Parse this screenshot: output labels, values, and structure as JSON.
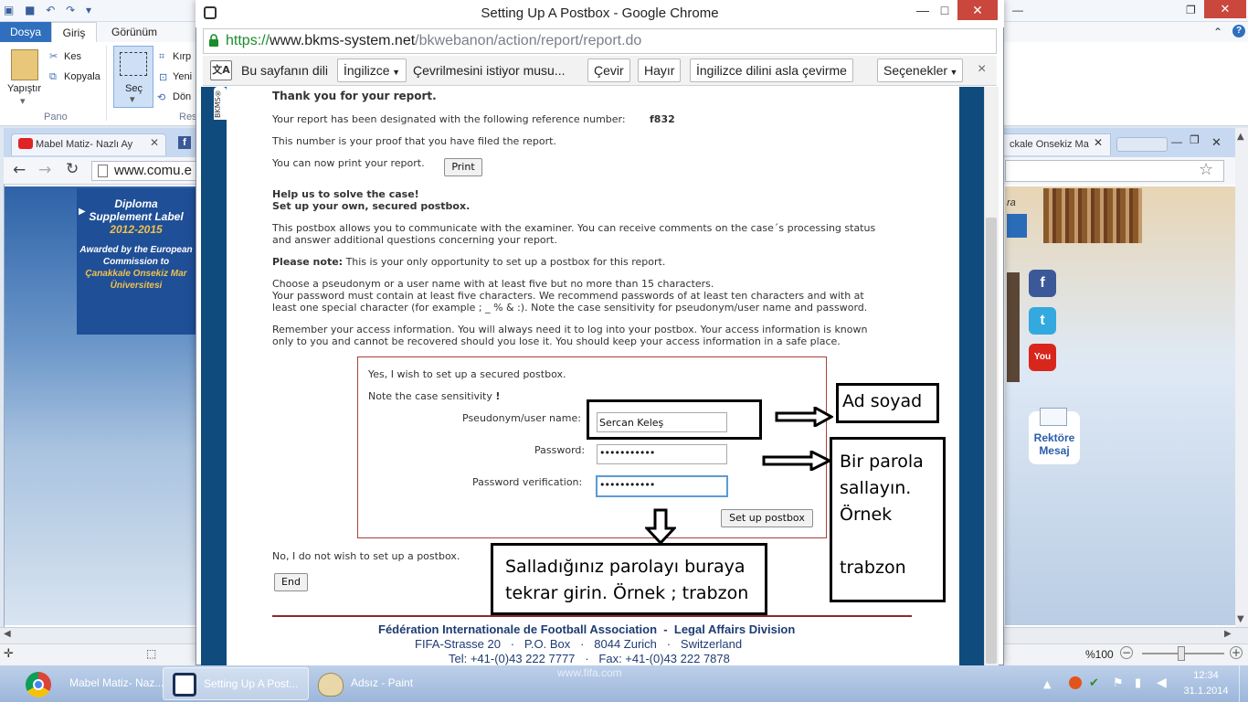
{
  "paint": {
    "tabs": {
      "file": "Dosya",
      "home": "Giriş",
      "view": "Görünüm"
    },
    "ribbon": {
      "paste": "Yapıştır",
      "cut": "Kes",
      "copy": "Kopyala",
      "clipboard_group": "Pano",
      "select": "Seç",
      "crop": "Kırp",
      "resize": "Yeni",
      "rotate": "Dön",
      "image_group": "Res"
    },
    "zoom": "%100"
  },
  "left_browser": {
    "tab_title": "Mabel Matiz- Nazlı Ay",
    "address": "www.comu.e",
    "banner": {
      "line1": "Diploma",
      "line2": "Supplement Label",
      "years": "2012-2015",
      "line3": "Awarded by the European",
      "line4": "Commission to",
      "line5": "Çanakkale Onsekiz Mar",
      "line6": "Üniversitesi"
    }
  },
  "right_browser": {
    "tab_title": "ckale Onsekiz Ma",
    "side_text": "ra",
    "rektore": {
      "line1": "Rektöre",
      "line2": "Mesaj"
    }
  },
  "popup": {
    "title": "Setting Up A Postbox - Google Chrome",
    "url": {
      "scheme": "https://",
      "domain": "www.bkms-system.net",
      "path": "/bkwebanon/action/report/report.do"
    },
    "translate_bar": {
      "prompt": "Bu sayfanın dili",
      "language": "İngilizce",
      "question": "Çevrilmesini istiyor musu...",
      "translate": "Çevir",
      "no": "Hayır",
      "never": "İngilizce dilini asla çevirme",
      "options": "Seçenekler",
      "close": "×"
    },
    "side_tab": "BKMS®",
    "page": {
      "thanks": "Thank you for your report.",
      "ref_label": "Your report has been designated with the following reference number:",
      "ref_number": "f832",
      "proof": "This number is your proof that you have filed the report.",
      "print_label": "You can now print your report.",
      "print_button": "Print",
      "help_title": "Help us to solve the case!",
      "help_sub": "Set up your own, secured postbox.",
      "p1a": "This postbox allows you to communicate with the examiner. You can receive comments on the case´s processing status",
      "p1b": "and answer additional questions concerning your report.",
      "note_label": "Please note:",
      "note_text": "This is your only opportunity to set up a postbox for this report.",
      "p2a": "Choose a pseudonym or a user name with at least five but no more than 15 characters.",
      "p2b": "Your password must contain at least five characters. We recommend passwords of at least ten characters and with at",
      "p2c": "least one special character (for example ; _ % & :). Note the case sensitivity for pseudonym/user name and password.",
      "p3a": "Remember your access information. You will always need it to log into your postbox. Your access information is known",
      "p3b": "only to you and cannot be recovered should you lose it. You should keep your access information in a safe place.",
      "form": {
        "yes": "Yes, I wish to set up a secured postbox.",
        "note": "Note the case sensitivity",
        "note_mark": "!",
        "user_label": "Pseudonym/user name:",
        "user_value": "Sercan Keleş",
        "pass_label": "Password:",
        "pass_value": "•••••••••••",
        "verify_label": "Password verification:",
        "verify_value": "•••••••••••",
        "submit": "Set up postbox"
      },
      "no_text": "No, I do not wish to set up a postbox.",
      "end_button": "End",
      "footer": {
        "org": "Fédération Internationale de Football Association",
        "sep": "-",
        "division": "Legal Affairs Division",
        "addr1": "FIFA-Strasse 20",
        "addr2": "P.O. Box",
        "addr3": "8044 Zurich",
        "addr4": "Switzerland",
        "tel": "Tel: +41-(0)43 222 7777",
        "fax": "Fax: +41-(0)43 222 7878",
        "web": "www.fifa.com"
      }
    }
  },
  "annotations": {
    "name": "Ad soyad",
    "pass": [
      "Bir parola",
      "sallayın.",
      "Örnek",
      "",
      "trabzon"
    ],
    "verify": [
      "Salladığınız parolayı buraya",
      "tekrar girin. Örnek ; trabzon"
    ]
  },
  "taskbar": {
    "items": [
      "Mabel Matiz- Naz...",
      "Setting Up A Post...",
      "Adsız - Paint"
    ],
    "time": "12:34",
    "date": "31.1.2014"
  },
  "colors": {
    "page_frame": "#0f4b7d",
    "form_border": "#a93f3f",
    "url_green": "#1a8c2e"
  }
}
